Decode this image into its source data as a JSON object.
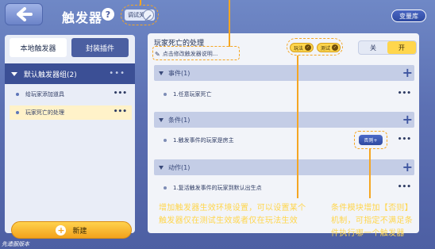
{
  "header": {
    "title": "触发器",
    "help_label": "?",
    "debug_label": "调试关",
    "variable_button": "变量库"
  },
  "left_panel": {
    "tab_local": "本地触发器",
    "tab_plugin": "封装插件",
    "group_label": "默认触发器组(2)",
    "group_dots": "•••",
    "items": [
      {
        "label": "给玩家添加道具",
        "dots": "•••"
      },
      {
        "label": "玩家死亡的处理",
        "dots": "•••"
      }
    ],
    "new_button": "新建",
    "new_plus": "+"
  },
  "version_text": "先遣服版本",
  "editor": {
    "trigger_name": "玩家死亡的处理",
    "description_placeholder": "点击修改触发器说明...",
    "env_play": "玩法",
    "env_test": "测试",
    "toggle_off": "关",
    "toggle_on": "开",
    "sections": [
      {
        "title": "事件(1)",
        "add": "+",
        "items": [
          {
            "label": "1.任意玩家死亡",
            "dots": "•••"
          }
        ]
      },
      {
        "title": "条件(1)",
        "add": "+",
        "items": [
          {
            "label": "1.触发事件的玩家是房主",
            "dots": "•••",
            "else_label": "否则+"
          }
        ]
      },
      {
        "title": "动作(1)",
        "add": "+",
        "items": [
          {
            "label": "1.复活触发事件的玩家到默认出生点",
            "dots": "•••"
          }
        ]
      }
    ]
  },
  "annotations": {
    "env": [
      "增加触发器生效环境设置，可以设置某个",
      "触发器仅在测试生效或者仅在玩法生效"
    ],
    "else": [
      "条件模块增加【否则】",
      "机制，可指定不满足条",
      "件执行哪一个触发器"
    ]
  },
  "colors": {
    "accent_yellow": "#ffd64d",
    "highlight_orange": "#f5a623",
    "header_blue": "#3b4f95"
  }
}
